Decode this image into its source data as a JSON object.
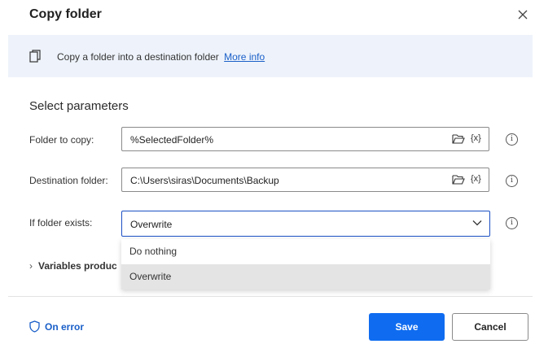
{
  "dialog": {
    "title": "Copy folder",
    "close_icon": "close-icon"
  },
  "banner": {
    "icon": "copy-icon",
    "text": "Copy a folder into a destination folder",
    "link": "More info"
  },
  "parameters": {
    "heading": "Select parameters",
    "folder_to_copy": {
      "label": "Folder to copy:",
      "value": "%SelectedFolder%",
      "var_icon": "{x}"
    },
    "destination_folder": {
      "label": "Destination folder:",
      "value": "C:\\Users\\siras\\Documents\\Backup",
      "var_icon": "{x}"
    },
    "if_folder_exists": {
      "label": "If folder exists:",
      "value": "Overwrite",
      "options": [
        "Do nothing",
        "Overwrite"
      ],
      "highlighted_option": "Overwrite"
    }
  },
  "variables_produced": {
    "label": "Variables produc"
  },
  "footer": {
    "on_error": "On error",
    "save": "Save",
    "cancel": "Cancel"
  },
  "colors": {
    "accent": "#0f6cf0",
    "link": "#1a5fc8",
    "banner_bg": "#eef3fb"
  }
}
